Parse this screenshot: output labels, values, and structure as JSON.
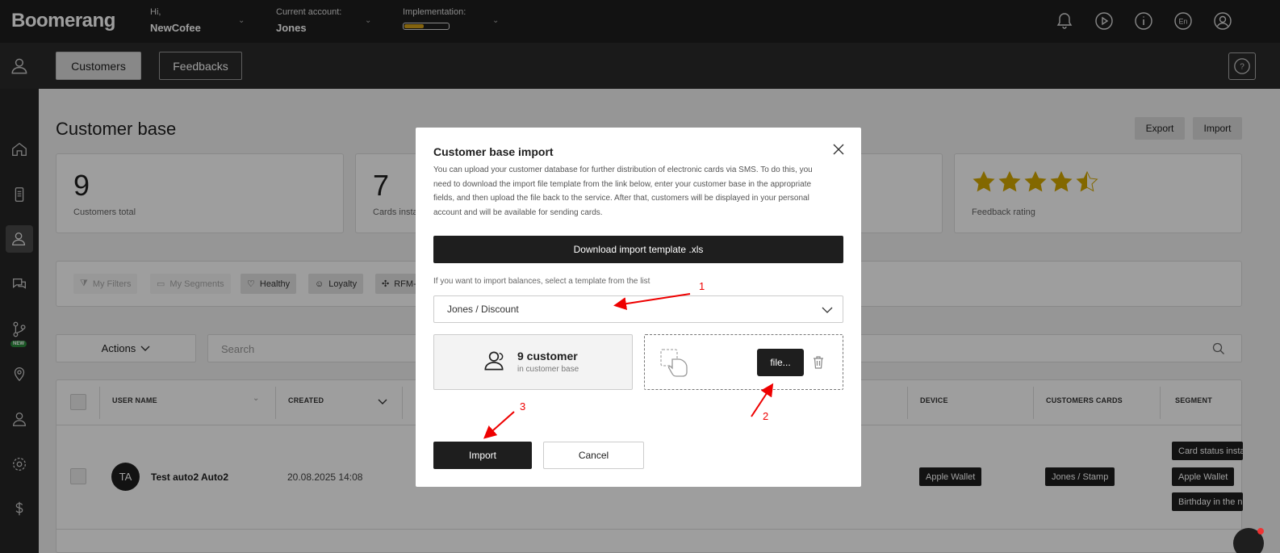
{
  "topbar": {
    "logo": "Boomerang",
    "greeting_label": "Hi,",
    "user_name": "NewCofee",
    "account_label": "Current account:",
    "account_name": "Jones",
    "implementation_label": "Implementation:",
    "implementation_progress": 0.45,
    "lang": "En"
  },
  "subbar": {
    "tabs": [
      {
        "label": "Customers",
        "active": true
      },
      {
        "label": "Feedbacks",
        "active": false
      }
    ],
    "help": "?"
  },
  "sidebar": {
    "items": [
      "user-circle-icon",
      "home-icon",
      "phone-icon",
      "customers-icon",
      "chat-icon",
      "flow-icon",
      "location-icon",
      "person-icon",
      "settings-icon",
      "dollar-icon"
    ],
    "new_badge": "NEW"
  },
  "main": {
    "title": "Customer base",
    "export_label": "Export",
    "import_label": "Import",
    "stats": [
      {
        "value": "9",
        "label": "Customers total"
      },
      {
        "value": "7",
        "label": "Cards insta"
      }
    ],
    "feedback_label": "Feedback rating",
    "feedback_stars": 4.5,
    "filters": [
      "My Filters",
      "My Segments",
      "Healthy",
      "Loyalty",
      "RFM-"
    ],
    "actions_label": "Actions",
    "search_placeholder": "Search",
    "table": {
      "columns": [
        "USER NAME",
        "CREATED",
        "DEVICE",
        "CUSTOMERS CARDS",
        "SEGMENT"
      ],
      "row": {
        "initials": "TA",
        "name": "Test auto2 Auto2",
        "created": "20.08.2025 14:08",
        "device": "Apple Wallet",
        "card": "Jones / Stamp",
        "segments": [
          "Card status insta",
          "Apple Wallet",
          "Birthday in the n"
        ]
      }
    }
  },
  "modal": {
    "title": "Customer base import",
    "description": "You can upload your customer database for further distribution of electronic cards via SMS. To do this, you need to download the import file template from the link below, enter your customer base in the appropriate fields, and then upload the file back to the service. After that, customers will be displayed in your personal account and will be available for sending cards.",
    "download_label": "Download import template .xls",
    "hint": "If you want to import balances, select a template from the list",
    "selected_template": "Jones / Discount",
    "count_main": "9 customer",
    "count_sub": "in customer base",
    "file_label": "file...",
    "import_label": "Import",
    "cancel_label": "Cancel"
  },
  "annotations": [
    "1",
    "2",
    "3"
  ],
  "colors": {
    "dark": "#1e1e1e",
    "accent_progress": "#d4a017",
    "star": "#d4a800",
    "annotation": "#e00000",
    "badge_new": "#2a8c3c"
  }
}
